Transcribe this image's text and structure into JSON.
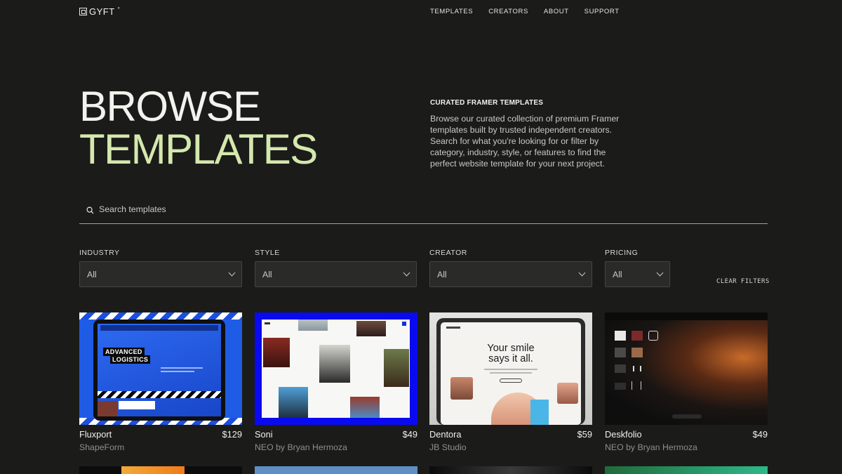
{
  "nav": {
    "logo_text": "GYFT",
    "logo_mark": "°",
    "links": [
      "TEMPLATES",
      "CREATORS",
      "ABOUT",
      "SUPPORT"
    ]
  },
  "hero": {
    "line1": "BROWSE",
    "line2": "TEMPLATES",
    "accent_color": "#d5e8ad"
  },
  "intro": {
    "eyebrow": "CURATED FRAMER TEMPLATES",
    "body": "Browse our curated collection of premium Framer templates built by trusted independent creators. Search for what you're looking for or filter by category, industry, style, or features to find the perfect website template for your next project."
  },
  "search": {
    "placeholder": "Search templates",
    "icon": "search-icon"
  },
  "filters": [
    {
      "label": "INDUSTRY",
      "value": "All"
    },
    {
      "label": "STYLE",
      "value": "All"
    },
    {
      "label": "CREATOR",
      "value": "All"
    },
    {
      "label": "PRICING",
      "value": "All"
    }
  ],
  "clear_filters": "CLEAR FILTERS",
  "templates": [
    {
      "name": "Fluxport",
      "price": "$129",
      "creator": "ShapeForm",
      "thumb_text": [
        "ADVANCED",
        "LOGISTICS"
      ]
    },
    {
      "name": "Soni",
      "price": "$49",
      "creator": "NEO by Bryan Hermoza"
    },
    {
      "name": "Dentora",
      "price": "$59",
      "creator": "JB Studio",
      "thumb_text": [
        "Your smile",
        "says it all."
      ]
    },
    {
      "name": "Deskfolio",
      "price": "$49",
      "creator": "NEO by Bryan Hermoza"
    }
  ],
  "colors": {
    "background": "#1b1b1a",
    "accent": "#d5e8ad",
    "fluxport_blue": "#1b4fe0",
    "soni_blue": "#0a0af0"
  }
}
